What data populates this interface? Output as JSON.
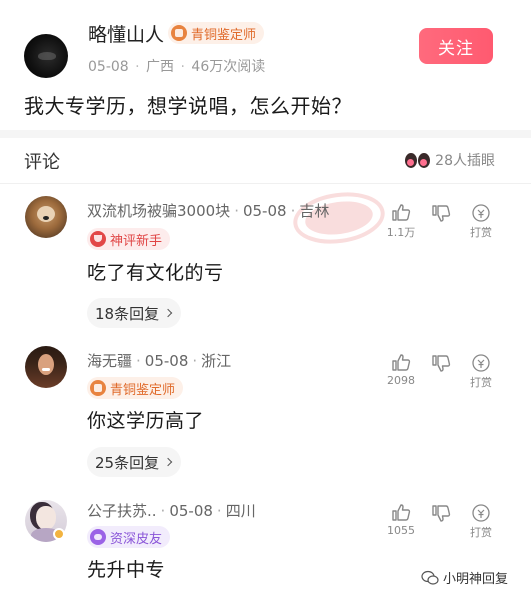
{
  "post": {
    "author_name": "略懂山人",
    "author_badge": "青铜鉴定师",
    "date": "05-08",
    "location": "广西",
    "reads": "46万次阅读",
    "follow_label": "关注",
    "question": "我大专学历，想学说唱，怎么开始？"
  },
  "comments_header": {
    "title": "评论",
    "viewers": "28人插眼"
  },
  "comments": [
    {
      "name": "双流机场被骗3000块",
      "date": "05-08",
      "location": "吉林",
      "badge": "神评新手",
      "text": "吃了有文化的亏",
      "replies": "18条回复",
      "likes": "1.1万",
      "tip": "打赏"
    },
    {
      "name": "海无疆",
      "date": "05-08",
      "location": "浙江",
      "badge": "青铜鉴定师",
      "text": "你这学历高了",
      "replies": "25条回复",
      "likes": "2098",
      "tip": "打赏"
    },
    {
      "name": "公子扶苏..",
      "date": "05-08",
      "location": "四川",
      "badge": "资深皮友",
      "text": "先升中专",
      "likes": "1055",
      "tip": "打赏"
    }
  ],
  "watermark": "小明神回复",
  "icons": {
    "avatar_1": "dog-avatar",
    "avatar_2": "woman-avatar",
    "avatar_3": "anime-avatar",
    "like": "thumbs-up-icon",
    "dislike": "thumbs-down-icon",
    "tip": "coin-icon",
    "viewers": "eyes-icon"
  },
  "colors": {
    "follow_button": "#ff5a70",
    "copper_badge": "#e06a2a",
    "red_badge": "#e04545",
    "purple_badge": "#8a55d8"
  }
}
